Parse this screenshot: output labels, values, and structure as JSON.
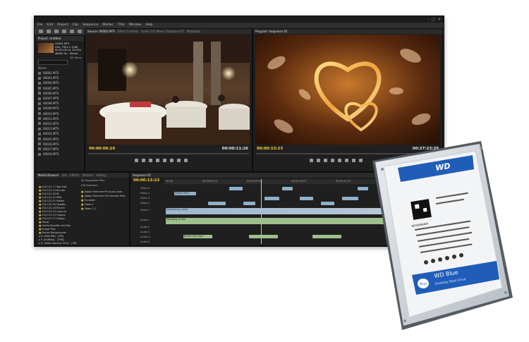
{
  "app": {
    "title": "",
    "menu": [
      "File",
      "Edit",
      "Project",
      "Clip",
      "Sequence",
      "Marker",
      "Title",
      "Window",
      "Help"
    ],
    "workspace_label": "Workspace:",
    "workspace_value": "Editing"
  },
  "project_panel": {
    "tab": "Project: Untitled",
    "clip_name": "00002.MTS",
    "clip_info": [
      "Film, 1920 x 1080",
      "00:00:18:14, 29.97p",
      "48000 Hz - Stereo"
    ],
    "items_count": "62 Items",
    "name_header": "Name",
    "items": [
      "00002.MTS",
      "00003.MTS",
      "00004.MTS",
      "00005.MTS",
      "00006.MTS",
      "00007.MTS",
      "00008.MTS",
      "00009.MTS",
      "00010.MTS",
      "00011.MTS",
      "00012.MTS",
      "00013.MTS",
      "00014.MTS",
      "00015.MTS",
      "00016.MTS",
      "00017.MTS",
      "00018.MTS"
    ]
  },
  "source_panel": {
    "tabs": [
      "Source: 00002.MTS",
      "Effect Controls",
      "Audio Clip Mixer: Sequence 01",
      "Metadata"
    ],
    "timecode_in": "00:00:06:10",
    "timecode_out": "00:00:11:26"
  },
  "program_panel": {
    "tab": "Program: Sequence 01",
    "timecode_in": "00:00:13:23",
    "timecode_out": "00:27:23:29"
  },
  "media_browser": {
    "tabs": [
      "Media Browser",
      "Info",
      "Effects",
      "Markers",
      "History"
    ],
    "files_of_type": "All Supported Files",
    "view_as": "File Directory",
    "folders": [
      "2012-01-17 Sap Kids",
      "2012-01-19 Kuruba",
      "2012-01-20 RL",
      "2012-01-21 RMS",
      "2012-02-01 Rotten",
      "2012-02-09 Hepatic",
      "2012-02-16 Ranchi",
      "2012-02-19 Cops Int",
      "2012-07-13 Graphic",
      "2012-07-17 Design",
      "Visual",
      "Online Benefits YouTube",
      "Image Files",
      "Motion Backgrounds"
    ],
    "drives": [
      "E: (DVD RW) - [PM]",
      "F: (Outflow) - [THB]",
      "G: (Video Backup 1912) - [TB]"
    ],
    "files": [
      "Adobe Premiere Pro Auto-Save",
      "Adobe Premiere Pro Preview Files",
      "Encoded",
      "Video 1",
      "Video 1_2"
    ]
  },
  "timeline": {
    "tab": "Sequence 01",
    "timecode": "00:00:13:23",
    "ruler": [
      "00:00",
      "00:00:04:23",
      "00:00:09:23",
      "00:00:14:23",
      "00:00:19:23",
      "00:00:24:23",
      "00:00:29:23"
    ],
    "tracks": [
      "Video 5",
      "Video 4",
      "Video 3",
      "Video 2",
      "Video 1",
      "Audio 1",
      "Audio 2",
      "Audio 3",
      "Audio 4",
      "Audio 5"
    ],
    "clip_label_a": "00002.MTS",
    "clip_label_b": "Intentional_Love1",
    "clip_label_c": "Wedding_Audio",
    "clip_label_d": "Bride Intro.mp3"
  },
  "drive": {
    "brand": "WD",
    "product": "WD Blue",
    "subtitle": "Desktop Hard Drive",
    "badge": "Blue",
    "lot": "WD5000AAKX"
  },
  "colors": {
    "tc_yellow": "#ffce3a",
    "video_clip": "#8fb0c9",
    "audio_clip": "#9fbf8c",
    "wd_blue": "#1f5db8"
  }
}
